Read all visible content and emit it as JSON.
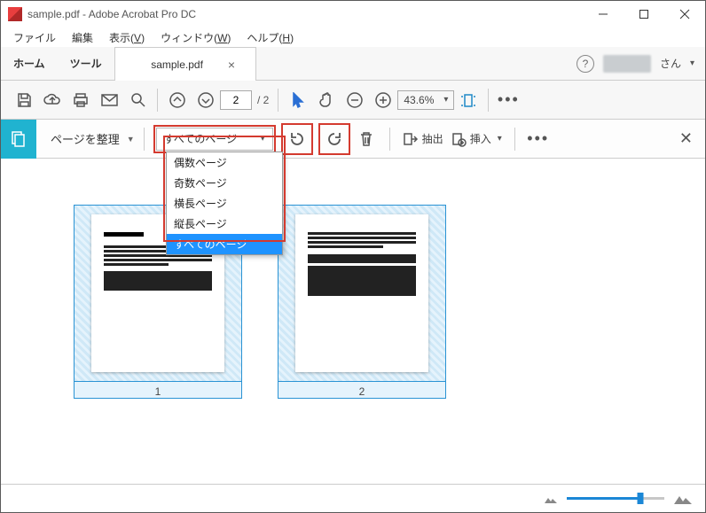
{
  "window": {
    "title": "sample.pdf - Adobe Acrobat Pro DC"
  },
  "menubar": {
    "file": "ファイル",
    "edit": "編集",
    "view": "表示",
    "view_u": "V",
    "window": "ウィンドウ",
    "window_u": "W",
    "help": "ヘルプ",
    "help_u": "H"
  },
  "tabs": {
    "home": "ホーム",
    "tools": "ツール",
    "doc": "sample.pdf",
    "user_suffix": "さん"
  },
  "toolbar": {
    "page_current": "2",
    "page_total": "/ 2",
    "zoom": "43.6%"
  },
  "organize": {
    "label": "ページを整理",
    "dropdown_selected": "すべてのページ",
    "options": [
      "偶数ページ",
      "奇数ページ",
      "横長ページ",
      "縦長ページ",
      "すべてのページ"
    ],
    "extract": "抽出",
    "insert": "挿入"
  },
  "thumbs": {
    "p1": "1",
    "p2": "2"
  }
}
